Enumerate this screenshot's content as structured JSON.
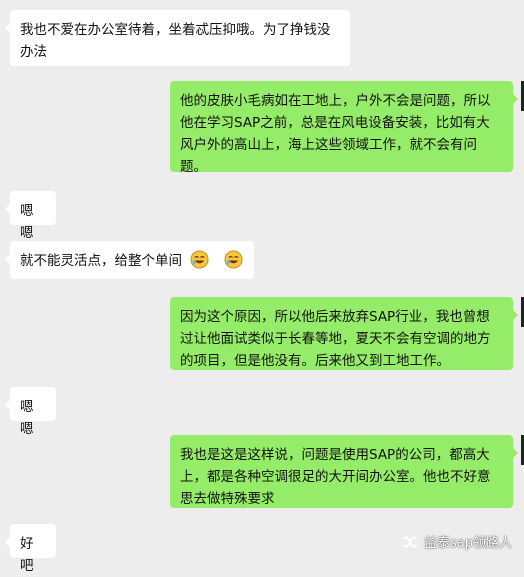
{
  "messages": [
    {
      "side": "left",
      "text": "我也不爱在办公室待着，坐着忒压抑哦。为了挣钱没办法"
    },
    {
      "side": "right",
      "text": "他的皮肤小毛病如在工地上，户外不会是问题，所以他在学习SAP之前，总是在风电设备安装，比如有大风户外的高山上，海上这些领域工作，就不会有问题。"
    },
    {
      "side": "left",
      "text": "嗯嗯"
    },
    {
      "side": "left",
      "text": "就不能灵活点，给整个单间"
    },
    {
      "side": "right",
      "text": "因为这个原因，所以他后来放弃SAP行业，我也曾想过让他面试类似于长春等地，夏天不会有空调的地方的项目，但是他没有。后来他又到工地工作。"
    },
    {
      "side": "left",
      "text": "嗯嗯"
    },
    {
      "side": "right",
      "text": "我也是这是这样说，问题是使用SAP的公司，都高大上，都是各种空调很足的大开间办公室。他也不好意思去做特殊要求"
    },
    {
      "side": "left",
      "text": "好吧"
    }
  ],
  "watermark": {
    "text": "益泰sap领路人",
    "icon": "wechat-channel-icon"
  },
  "colors": {
    "background": "#ededed",
    "left_bubble": "#ffffff",
    "right_bubble": "#95ec69"
  }
}
